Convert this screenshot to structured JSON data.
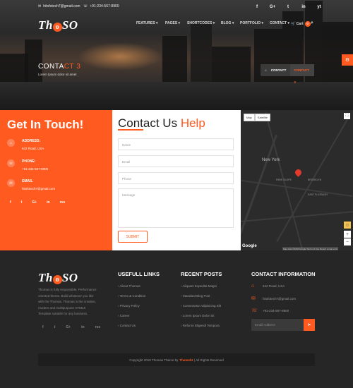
{
  "topbar": {
    "email": "hitofotech7@gmail.com",
    "phone": "+91-234-567-8900",
    "social": [
      "f",
      "G+",
      "t",
      "in",
      "yt"
    ]
  },
  "brand": {
    "logo_pre": "Th",
    "logo_o": "o",
    "logo_post": "SO"
  },
  "nav": {
    "items": [
      "FEATURES",
      "PAGES",
      "SHORTCODES",
      "BLOG",
      "PORTFOLIO",
      "CONTACT"
    ],
    "cart_label": "Cart",
    "cart_count": "0"
  },
  "page": {
    "title_a": "CONTA",
    "title_b": "CT 3",
    "subtitle": "Lorem Ipsum dolor sit amet",
    "crumb_home": "CONTACT",
    "crumb_active": "CONTACT 3"
  },
  "touch": {
    "heading": "Get In Touch!",
    "address_label": "ADDRESS:",
    "address_value": "542 Road, USA",
    "phone_label": "PHONE:",
    "phone_value": "+91-234-567-8900",
    "email_label": "EMAIL",
    "email_value": "hitofotech7@gmail.com",
    "social": [
      "f",
      "t",
      "G+",
      "in",
      "rss"
    ]
  },
  "form": {
    "heading_a": "Contact Us",
    "heading_b": "Help",
    "name_ph": "Name",
    "email_ph": "Email",
    "phone_ph": "Phone",
    "message_ph": "Message",
    "submit": "SUBMIT"
  },
  "map": {
    "tab_map": "Map",
    "tab_sat": "Satellite",
    "labels": [
      "New York",
      "PARK SLOPE",
      "BROOKLYN",
      "EAST FLATBUSH"
    ],
    "google": "Google",
    "attribution": "Map data ©2018 Google  Terms of Use  Report a map error"
  },
  "footer": {
    "about": "Thomas is fully responsible, Performance oriented theme. Build whatever you like with the Thomas. Thomas is the creative, modern and multipurpose HTML5 Template suitable for any business.",
    "social": [
      "f",
      "t",
      "G+",
      "in",
      "rss"
    ],
    "links_title": "USEFULL LINKS",
    "links": [
      "About Thomas",
      "Terms & Condition",
      "Privacy Policy",
      "Career",
      "Contact Us"
    ],
    "posts_title": "RECENT POSTS",
    "posts": [
      "Aliquam Expedita Magni",
      "Standard Blog Post",
      "Consectetur Adipisicing Elit",
      "Lorem Ipsum Dolor Sit",
      "Refonre Eligendi Tempora"
    ],
    "contact_title": "CONTACT INFORMATION",
    "contact_address": "542 Road, USA",
    "contact_email": "hitofotech7@gmail.com",
    "contact_phone": "+91-234-567-8900",
    "email_ph": "Email Address",
    "copy_a": "Copyright 2018 Thomas Theme by",
    "copy_brand": "Themeht",
    "copy_b": "| All Rights Reserved"
  }
}
